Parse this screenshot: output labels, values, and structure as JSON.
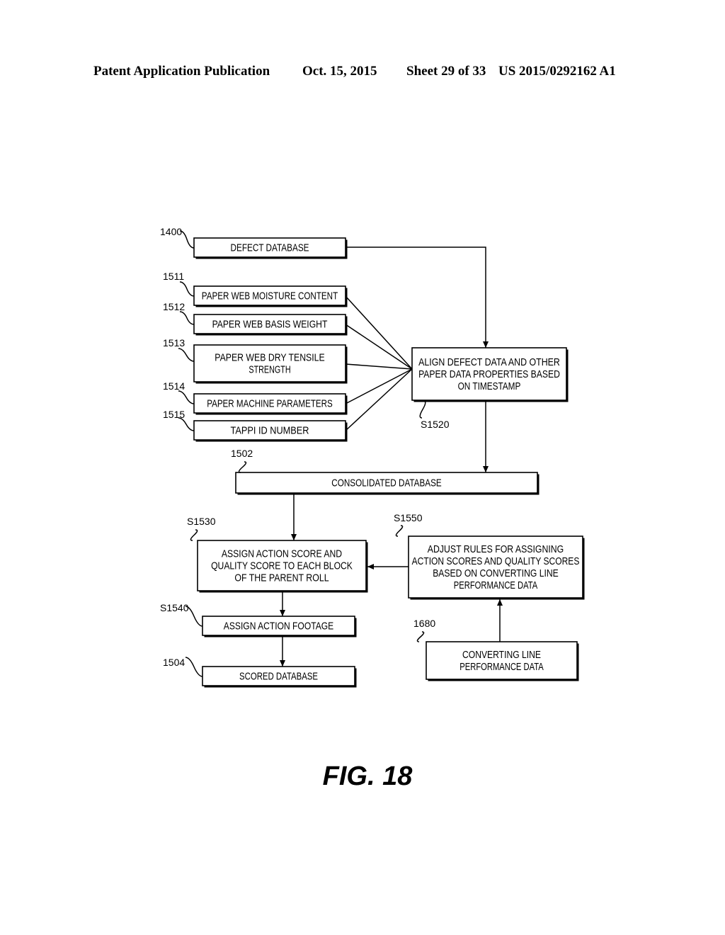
{
  "header": {
    "publication": "Patent Application Publication",
    "date": "Oct. 15, 2015",
    "sheet": "Sheet 29 of 33",
    "number": "US 2015/0292162 A1"
  },
  "figure_label": "FIG. 18",
  "nodes": {
    "defect_db": {
      "ref": "1400",
      "lines": [
        "DEFECT DATABASE"
      ]
    },
    "moisture": {
      "ref": "1511",
      "lines": [
        "PAPER WEB MOISTURE CONTENT"
      ]
    },
    "basis_weight": {
      "ref": "1512",
      "lines": [
        "PAPER WEB BASIS WEIGHT"
      ]
    },
    "tensile": {
      "ref": "1513",
      "lines": [
        "PAPER WEB DRY TENSILE",
        "STRENGTH"
      ]
    },
    "machine_params": {
      "ref": "1514",
      "lines": [
        "PAPER MACHINE PARAMETERS"
      ]
    },
    "tappi": {
      "ref": "1515",
      "lines": [
        "TAPPI ID NUMBER"
      ]
    },
    "align": {
      "ref": "S1520",
      "lines": [
        "ALIGN DEFECT DATA AND OTHER",
        "PAPER DATA PROPERTIES BASED",
        "ON TIMESTAMP"
      ]
    },
    "consolidated": {
      "ref": "1502",
      "lines": [
        "CONSOLIDATED DATABASE"
      ]
    },
    "assign_scores": {
      "ref": "S1530",
      "lines": [
        "ASSIGN ACTION SCORE AND",
        "QUALITY SCORE TO EACH BLOCK",
        "OF THE PARENT ROLL"
      ]
    },
    "adjust_rules": {
      "ref": "S1550",
      "lines": [
        "ADJUST RULES FOR ASSIGNING",
        "ACTION SCORES AND QUALITY SCORES",
        "BASED ON CONVERTING LINE",
        "PERFORMANCE DATA"
      ]
    },
    "assign_footage": {
      "ref": "S1540",
      "lines": [
        "ASSIGN ACTION FOOTAGE"
      ]
    },
    "scored_db": {
      "ref": "1504",
      "lines": [
        "SCORED DATABASE"
      ]
    },
    "converting": {
      "ref": "1680",
      "lines": [
        "CONVERTING LINE",
        "PERFORMANCE DATA"
      ]
    }
  },
  "edges": [
    {
      "from": "defect_db",
      "to": "align"
    },
    {
      "from": "moisture",
      "to": "align"
    },
    {
      "from": "basis_weight",
      "to": "align"
    },
    {
      "from": "tensile",
      "to": "align"
    },
    {
      "from": "machine_params",
      "to": "align"
    },
    {
      "from": "tappi",
      "to": "align"
    },
    {
      "from": "align",
      "to": "consolidated"
    },
    {
      "from": "consolidated",
      "to": "assign_scores"
    },
    {
      "from": "adjust_rules",
      "to": "assign_scores"
    },
    {
      "from": "converting",
      "to": "adjust_rules"
    },
    {
      "from": "assign_scores",
      "to": "assign_footage"
    },
    {
      "from": "assign_footage",
      "to": "scored_db"
    }
  ]
}
